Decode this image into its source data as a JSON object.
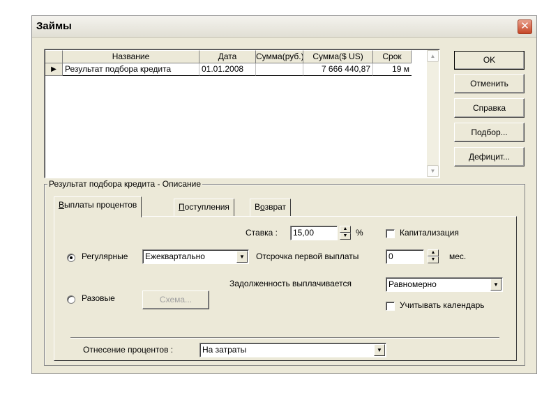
{
  "window": {
    "title": "Займы"
  },
  "buttons": {
    "ok": "OK",
    "cancel": "Отменить",
    "help": "Справка",
    "select": "Подбор...",
    "deficit": "Дефицит..."
  },
  "grid": {
    "columns": [
      "Название",
      "Дата",
      "Сумма(руб.)",
      "Сумма($ US)",
      "Срок"
    ],
    "rows": [
      {
        "name": "Результат подбора кредита",
        "date": "01.01.2008",
        "sum_rub": "",
        "sum_usd": "7 666 440,87",
        "term": "19 м"
      }
    ]
  },
  "group": {
    "label": "Результат подбора кредита - Описание"
  },
  "tabs": [
    {
      "label": "Выплаты процентов",
      "accel": "В",
      "rest": "ыплаты процентов"
    },
    {
      "label": "Поступления",
      "accel": "П",
      "rest": "оступления"
    },
    {
      "label": "Возврат",
      "pre": "В",
      "accel": "о",
      "rest": "зврат"
    }
  ],
  "form": {
    "rate_label": "Ставка :",
    "rate_value": "15,00",
    "rate_unit": "%",
    "capitalization_label": "Капитализация",
    "capitalization_checked": false,
    "regular_label": "Регулярные",
    "regular_selected": true,
    "frequency_value": "Ежеквартально",
    "deferral_label": "Отсрочка первой выплаты",
    "deferral_value": "0",
    "deferral_unit": "мес.",
    "debt_label": "Задолженность выплачивается",
    "debt_value": "Равномерно",
    "calendar_label": "Учитывать календарь",
    "calendar_checked": false,
    "onetime_label": "Разовые",
    "onetime_selected": false,
    "schema_button": "Схема...",
    "attribution_label": "Отнесение процентов :",
    "attribution_value": "На затраты"
  }
}
